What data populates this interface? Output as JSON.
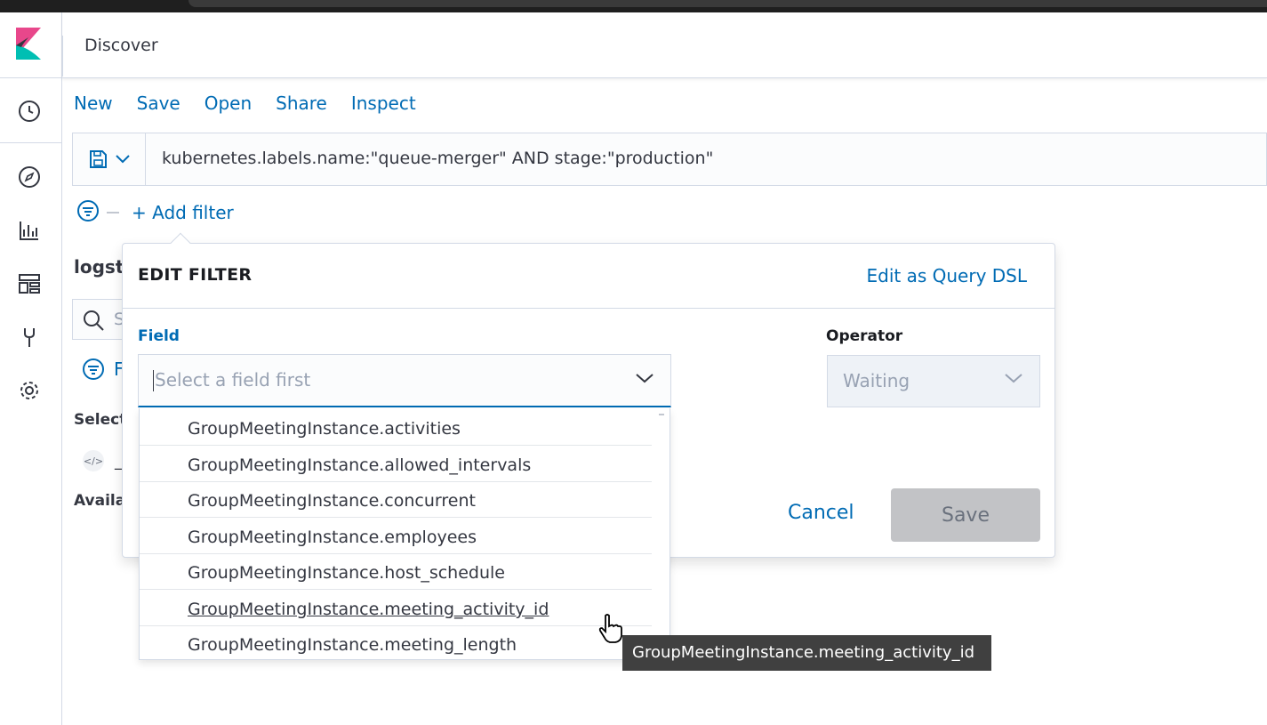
{
  "header": {
    "title": "Discover"
  },
  "topnav": {
    "items": [
      "New",
      "Save",
      "Open",
      "Share",
      "Inspect"
    ]
  },
  "query": {
    "text": "kubernetes.labels.name:\"queue-merger\" AND stage:\"production\""
  },
  "filter": {
    "add_label": "+ Add filter"
  },
  "background": {
    "index_label": "logst",
    "search_placeholder": "S",
    "filter_letter": "F",
    "selected_label": "Select",
    "source_field": "_",
    "available_label": "Availa"
  },
  "popover": {
    "title": "EDIT FILTER",
    "dsl_link": "Edit as Query DSL",
    "field_label": "Field",
    "field_placeholder": "Select a field first",
    "operator_label": "Operator",
    "operator_value": "Waiting",
    "cancel_label": "Cancel",
    "save_label": "Save"
  },
  "dropdown": {
    "options": [
      "GroupMeetingInstance.activities",
      "GroupMeetingInstance.allowed_intervals",
      "GroupMeetingInstance.concurrent",
      "GroupMeetingInstance.employees",
      "GroupMeetingInstance.host_schedule",
      "GroupMeetingInstance.meeting_activity_id",
      "GroupMeetingInstance.meeting_length"
    ],
    "hovered_index": 5
  },
  "tooltip": {
    "text": "GroupMeetingInstance.meeting_activity_id"
  },
  "colors": {
    "link": "#006bb4",
    "logo_pink": "#e8478b",
    "logo_teal": "#00bfb3",
    "logo_dark": "#343741"
  }
}
